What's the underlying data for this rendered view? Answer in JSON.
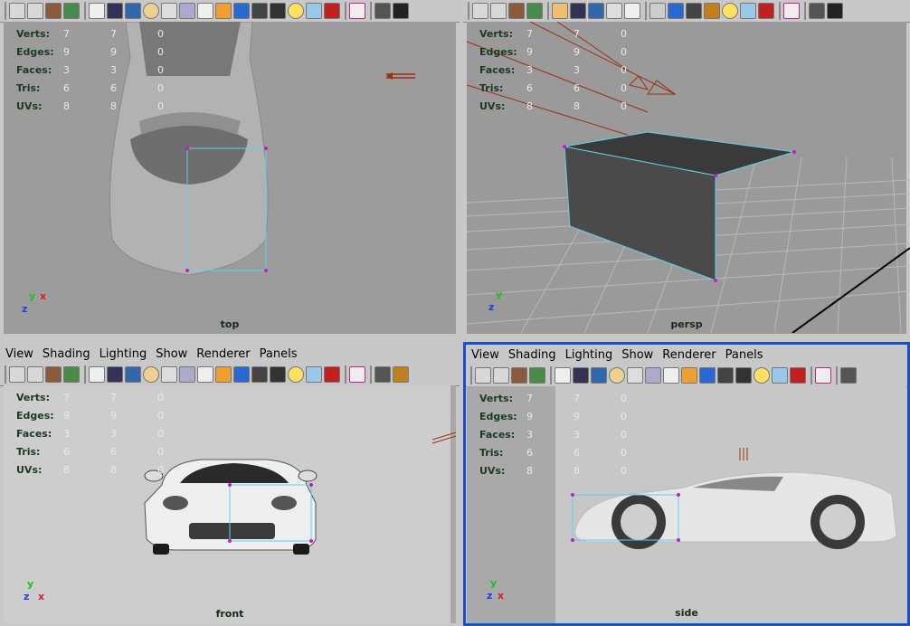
{
  "menu": [
    "View",
    "Shading",
    "Lighting",
    "Show",
    "Renderer",
    "Panels"
  ],
  "hud": {
    "labels": [
      "Verts:",
      "Edges:",
      "Faces:",
      "Tris:",
      "UVs:"
    ],
    "values": [
      [
        "7",
        "7",
        "0"
      ],
      [
        "9",
        "9",
        "0"
      ],
      [
        "3",
        "3",
        "0"
      ],
      [
        "6",
        "6",
        "0"
      ],
      [
        "8",
        "8",
        "0"
      ]
    ]
  },
  "views": {
    "top": "top",
    "persp": "persp",
    "front": "front",
    "side": "side"
  },
  "axes": {
    "x": "x",
    "y": "y",
    "z": "z"
  },
  "colors": {
    "selection": "#5fd0e8",
    "active_border": "#1a4fc8",
    "viewport_bg": "#9a9a9a",
    "grid": "#b6b6b6"
  }
}
